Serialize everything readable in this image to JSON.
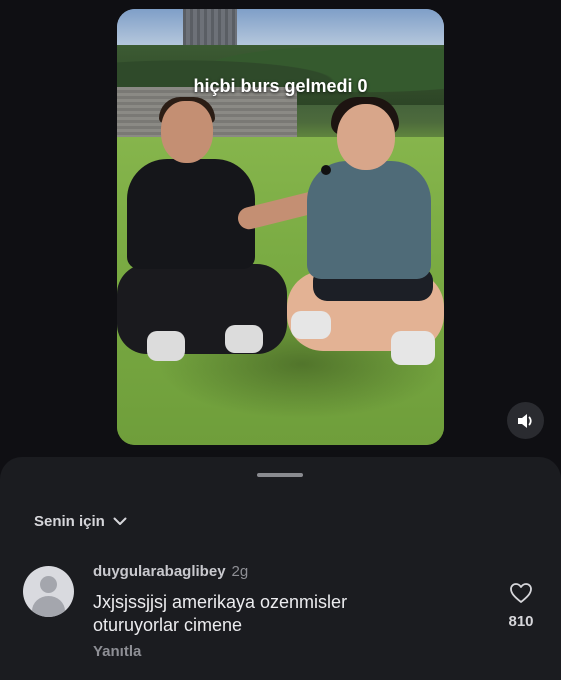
{
  "video": {
    "caption": "hiçbi burs gelmedi 0"
  },
  "controls": {
    "sound_icon": "speaker-icon"
  },
  "comments_sheet": {
    "sort_label": "Senin için",
    "sort_icon": "chevron-down-icon"
  },
  "comment": {
    "username": "duygularabaglibey",
    "time": "2g",
    "text": "Jxjsjssjjsj amerikaya ozenmisler oturuyorlar cimene",
    "reply_label": "Yanıtla",
    "like_icon": "heart-icon",
    "like_count": "810"
  }
}
